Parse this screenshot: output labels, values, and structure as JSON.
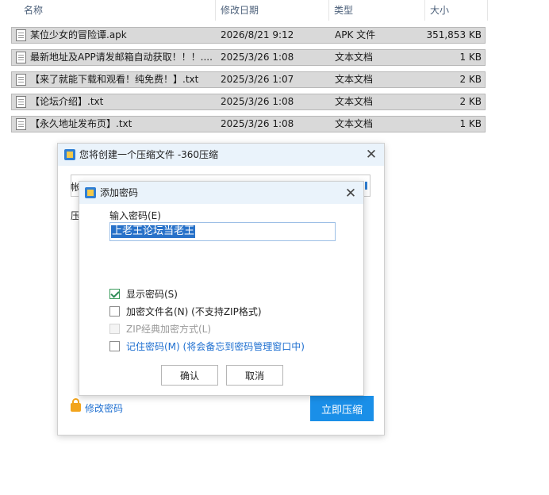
{
  "explorer": {
    "columns": {
      "name": "名称",
      "date": "修改日期",
      "type": "类型",
      "size": "大小"
    },
    "sort_indicator": "^",
    "files": [
      {
        "name": "某位少女的冒险谭.apk",
        "date": "2026/8/21 9:12",
        "type": "APK 文件",
        "size": "351,853 KB"
      },
      {
        "name": "最新地址及APP请发邮箱自动获取！！！....",
        "date": "2025/3/26 1:08",
        "type": "文本文档",
        "size": "1 KB"
      },
      {
        "name": "【来了就能下载和观看！纯免费！】.txt",
        "date": "2025/3/26 1:07",
        "type": "文本文档",
        "size": "2 KB"
      },
      {
        "name": "【论坛介绍】.txt",
        "date": "2025/3/26 1:08",
        "type": "文本文档",
        "size": "2 KB"
      },
      {
        "name": "【永久地址发布页】.txt",
        "date": "2025/3/26 1:08",
        "type": "文本文档",
        "size": "1 KB"
      }
    ]
  },
  "compress_dialog": {
    "title": "您将创建一个压缩文件 -360压缩",
    "stub_char_1": "帐",
    "stub_char_2": "压",
    "change_password_link": "修改密码",
    "compress_button": "立即压缩",
    "close_glyph": "✕"
  },
  "password_dialog": {
    "title": "添加密码",
    "close_glyph": "✕",
    "input_label": "输入密码(E)",
    "password_value": "上老王论坛当老王",
    "options": [
      {
        "label": "显示密码(S)",
        "checked": true,
        "disabled": false,
        "style": "normal"
      },
      {
        "label": "加密文件名(N) (不支持ZIP格式)",
        "checked": false,
        "disabled": false,
        "style": "normal"
      },
      {
        "label": "ZIP经典加密方式(L)",
        "checked": false,
        "disabled": true,
        "style": "muted"
      },
      {
        "label": "记住密码(M) (将会备忘到密码管理窗口中)",
        "checked": false,
        "disabled": false,
        "style": "blue"
      }
    ],
    "ok_button": "确认",
    "cancel_button": "取消"
  },
  "colors": {
    "accent_blue": "#1a8fe8",
    "link_blue": "#1e6fd0",
    "selection_gray": "#d9d9d9",
    "titlebar_bg": "#eaf3fb"
  }
}
